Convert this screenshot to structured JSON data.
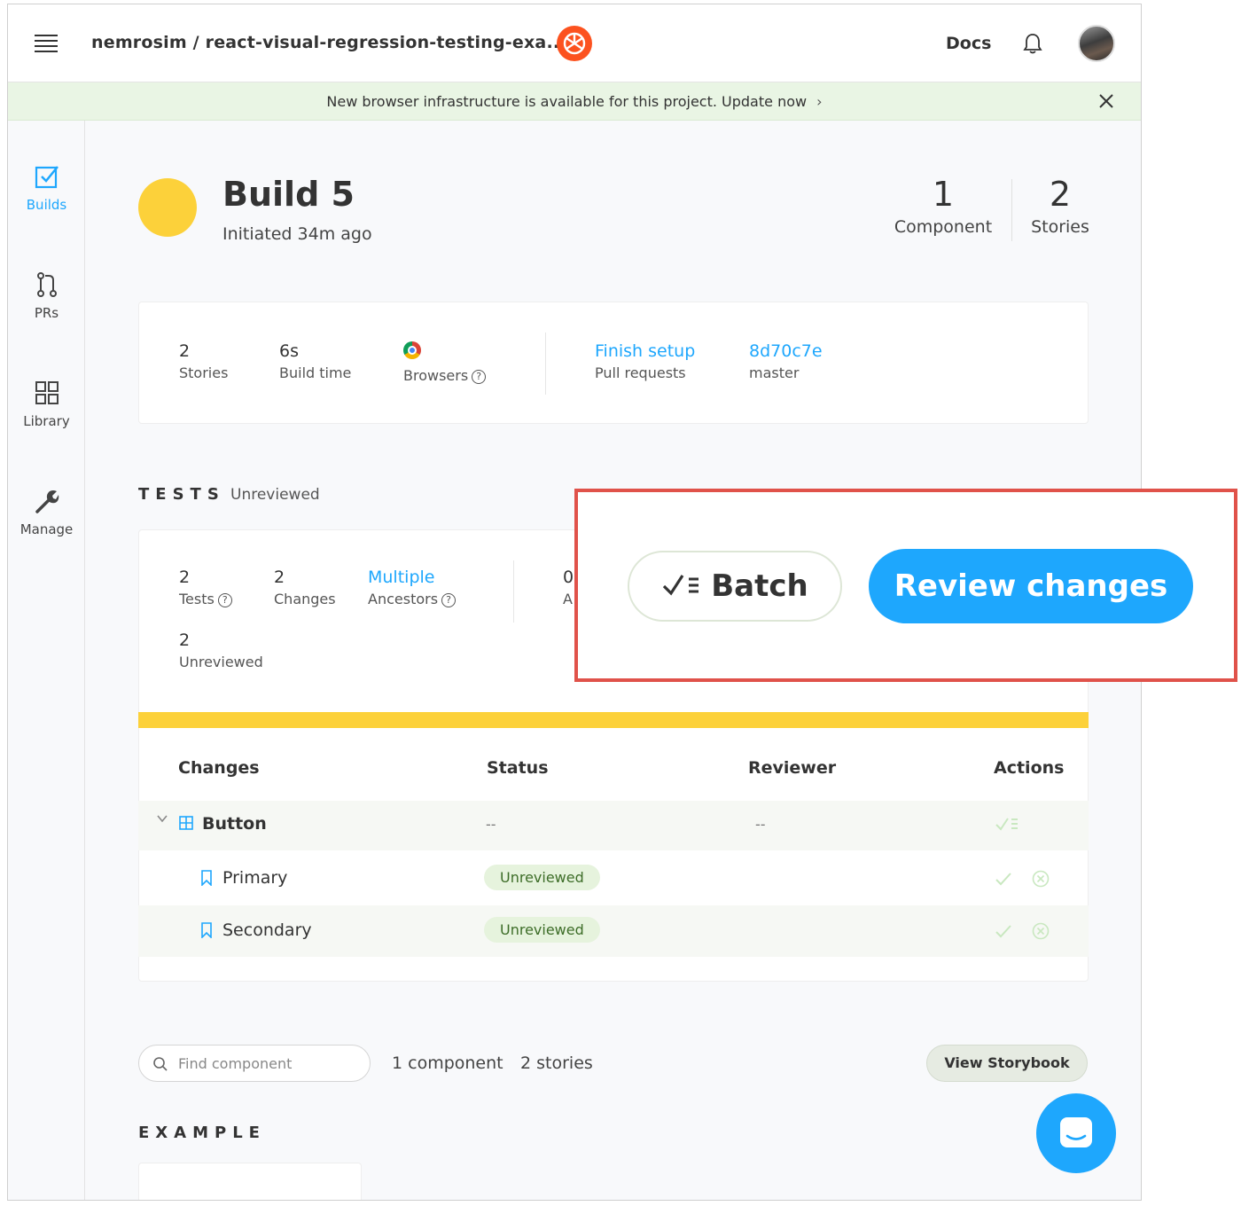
{
  "header": {
    "repo": "nemrosim / react-visual-regression-testing-exa...",
    "docs_label": "Docs"
  },
  "banner": {
    "text": "New browser infrastructure is available for this project. Update now",
    "chevron": "›"
  },
  "sidebar": {
    "items": [
      {
        "label": "Builds",
        "icon": "builds-icon",
        "active": true
      },
      {
        "label": "PRs",
        "icon": "pull-request-icon"
      },
      {
        "label": "Library",
        "icon": "grid-icon"
      },
      {
        "label": "Manage",
        "icon": "wrench-icon"
      }
    ]
  },
  "build": {
    "title": "Build 5",
    "subtitle": "Initiated 34m ago",
    "status_color": "#fcd13a",
    "components_count": "1",
    "components_label": "Component",
    "stories_count": "2",
    "stories_label": "Stories"
  },
  "summary": {
    "stories_value": "2",
    "stories_label": "Stories",
    "build_time_value": "6s",
    "build_time_label": "Build time",
    "browsers_label": "Browsers",
    "pr_value": "Finish setup",
    "pr_label": "Pull requests",
    "commit_value": "8d70c7e",
    "branch_label": "master"
  },
  "tests": {
    "title": "TESTS",
    "status": "Unreviewed",
    "tests_value": "2",
    "tests_label": "Tests",
    "changes_value": "2",
    "changes_label": "Changes",
    "ancestors_value": "Multiple",
    "ancestors_label": "Ancestors",
    "unreviewed_value": "2",
    "unreviewed_label": "Unreviewed",
    "partial_value": "0",
    "partial_label": "A"
  },
  "callout": {
    "batch_label": "Batch",
    "review_label": "Review changes",
    "border_color": "#e0524a",
    "accent": "#1ea7fd"
  },
  "table": {
    "headers": [
      "Changes",
      "Status",
      "Reviewer",
      "Actions"
    ],
    "component": {
      "name": "Button",
      "status": "--",
      "reviewer": "--"
    },
    "stories": [
      {
        "name": "Primary",
        "status": "Unreviewed"
      },
      {
        "name": "Secondary",
        "status": "Unreviewed"
      }
    ]
  },
  "footer": {
    "search_placeholder": "Find component",
    "component_count": "1 component",
    "story_count": "2 stories",
    "storybook_label": "View Storybook",
    "section_title": "EXAMPLE"
  }
}
